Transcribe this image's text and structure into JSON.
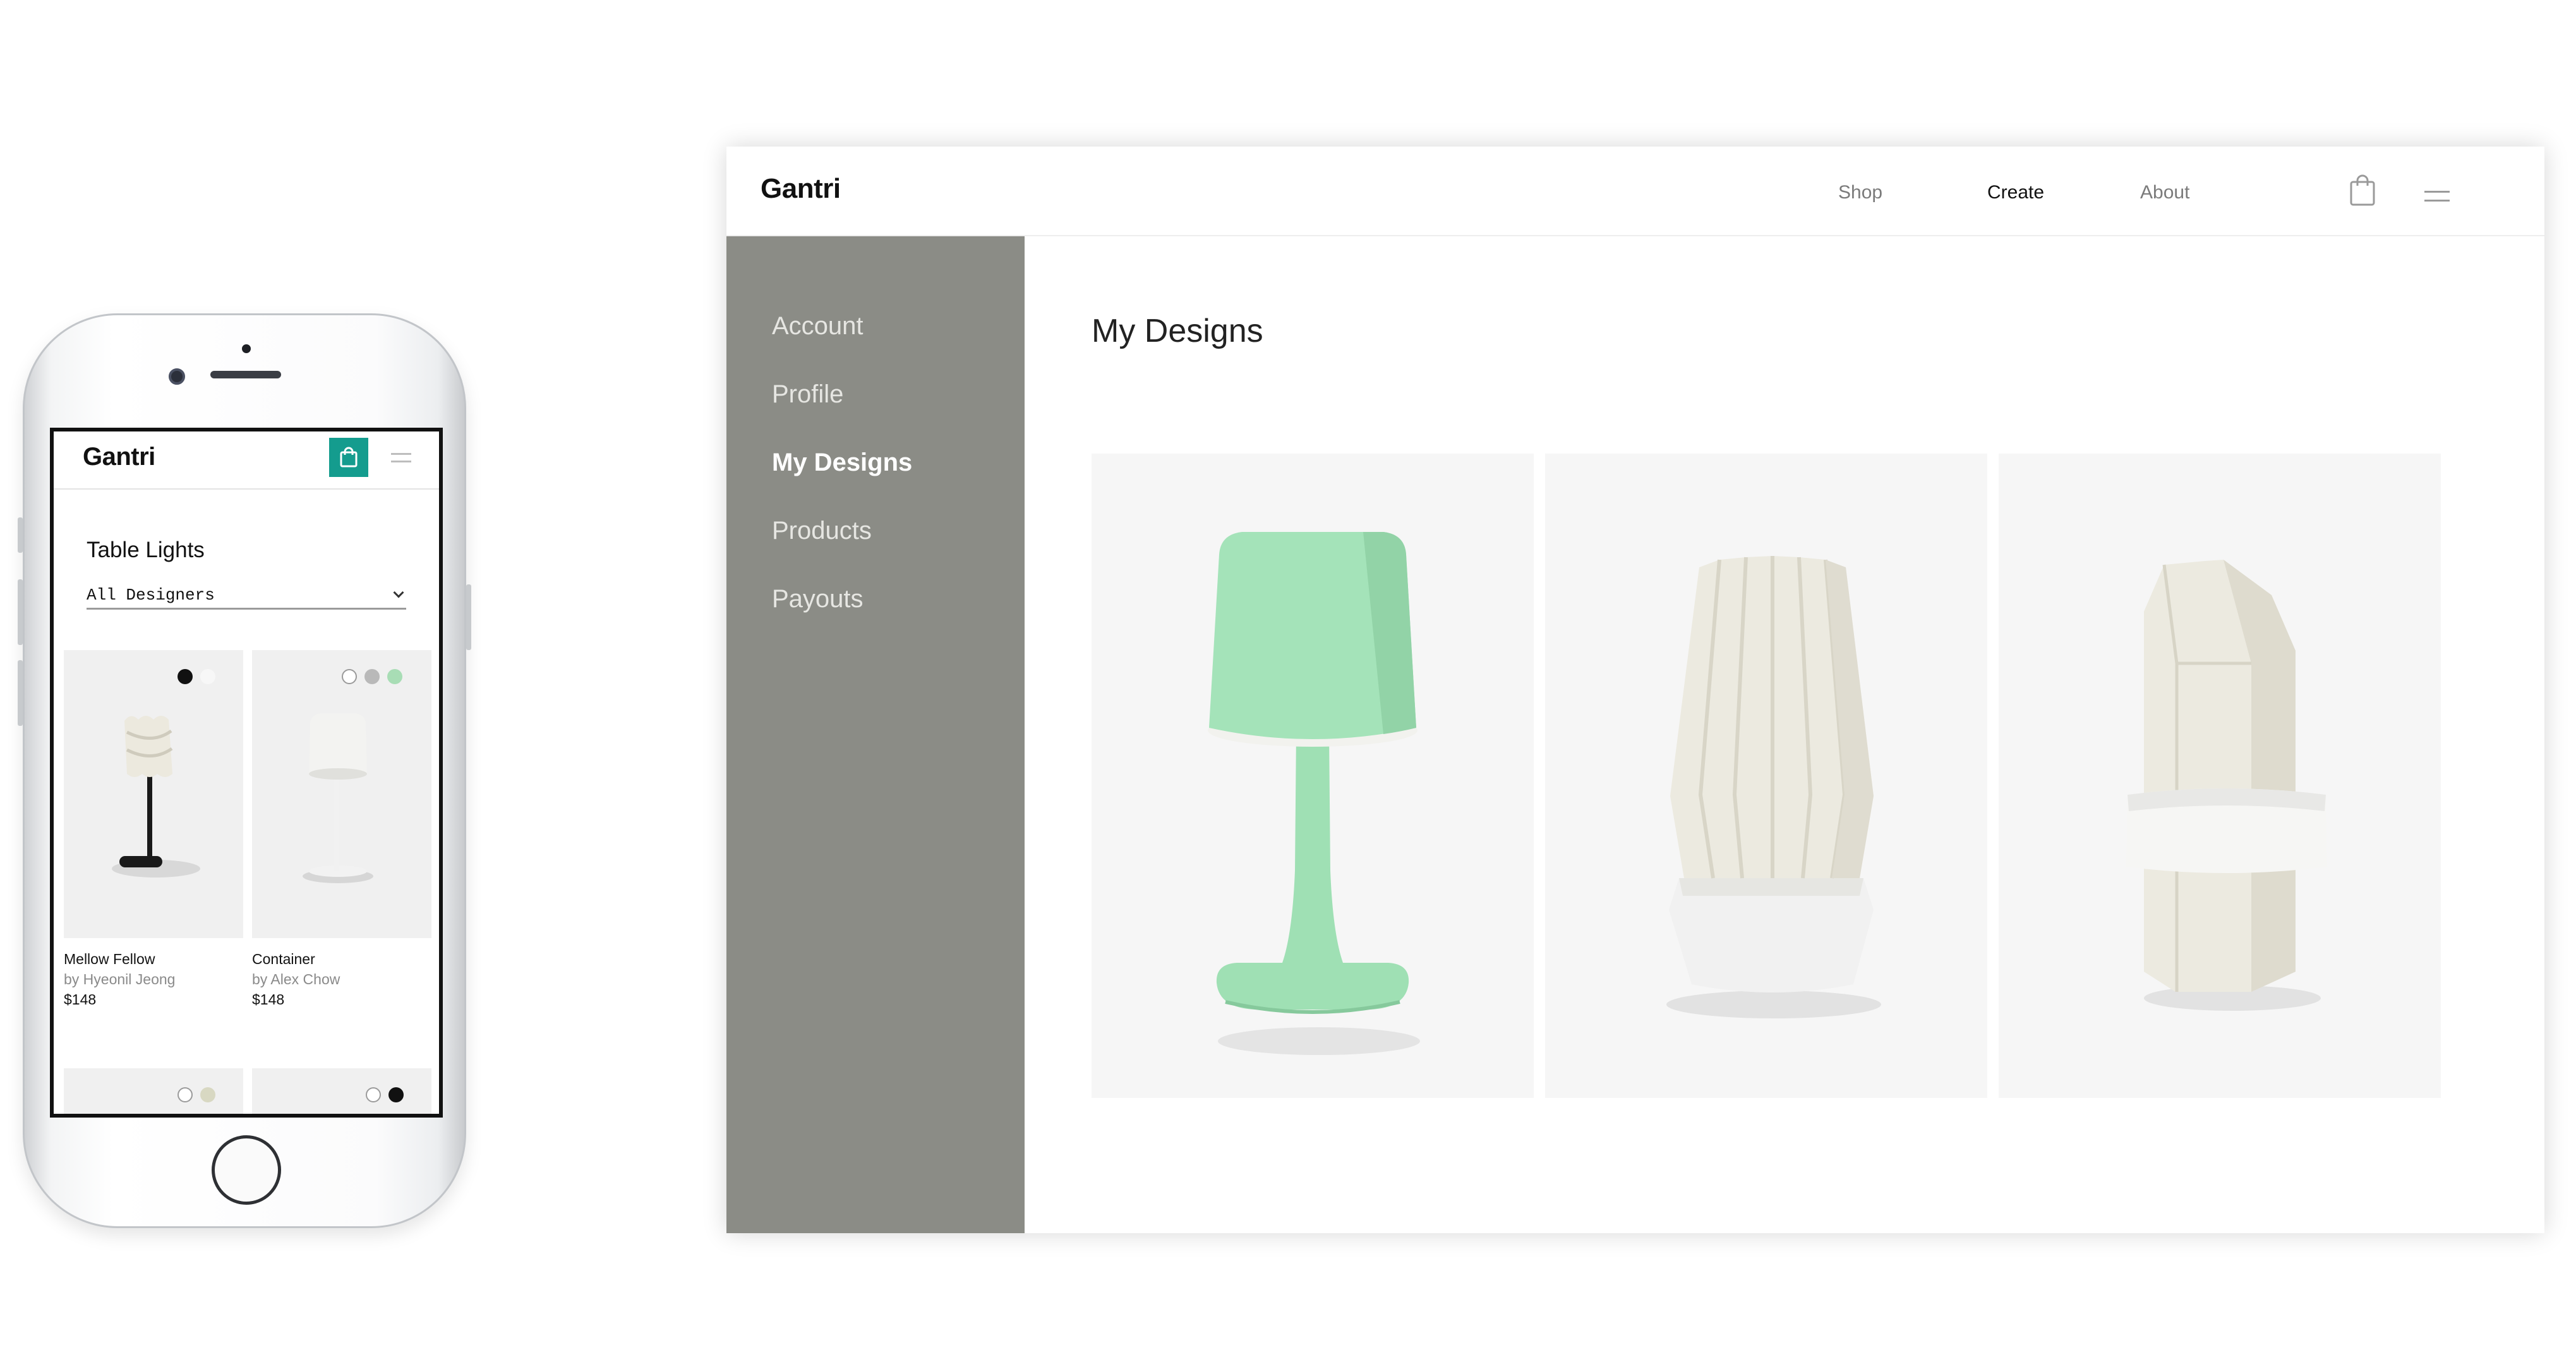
{
  "mobile": {
    "logo": "Gantri",
    "page_title": "Table Lights",
    "filter": {
      "selected": "All Designers"
    },
    "products": [
      {
        "name": "Mellow Fellow",
        "designer": "by Hyeonil Jeong",
        "price": "$148",
        "swatches": [
          "#111111",
          "#f4f4f4"
        ]
      },
      {
        "name": "Container",
        "designer": "by Alex Chow",
        "price": "$148",
        "swatches": [
          "#ffffff",
          "#b9b9b9",
          "#a8ddb5"
        ]
      },
      {
        "swatches": [
          "#ffffff",
          "#d8d8c2"
        ]
      },
      {
        "swatches": [
          "#ffffff",
          "#111111"
        ]
      }
    ],
    "accent_color": "#149c8e",
    "icons": [
      "shopping-bag-icon",
      "hamburger-menu-icon",
      "chevron-down-icon"
    ]
  },
  "desktop": {
    "logo": "Gantri",
    "nav": [
      {
        "label": "Shop",
        "active": false
      },
      {
        "label": "Create",
        "active": true
      },
      {
        "label": "About",
        "active": false
      }
    ],
    "sidebar": {
      "items": [
        {
          "label": "Account",
          "active": false
        },
        {
          "label": "Profile",
          "active": false
        },
        {
          "label": "My Designs",
          "active": true
        },
        {
          "label": "Products",
          "active": false
        },
        {
          "label": "Payouts",
          "active": false
        }
      ],
      "background_color": "#8b8c86"
    },
    "main": {
      "title": "My Designs",
      "designs": [
        {
          "color": "#9fe0b4",
          "kind": "table-lamp"
        },
        {
          "color": "#eceae0",
          "kind": "pleated-vase"
        },
        {
          "color": "#eceae0",
          "kind": "crystal"
        }
      ]
    },
    "icons": [
      "shopping-bag-icon",
      "hamburger-menu-icon"
    ]
  }
}
